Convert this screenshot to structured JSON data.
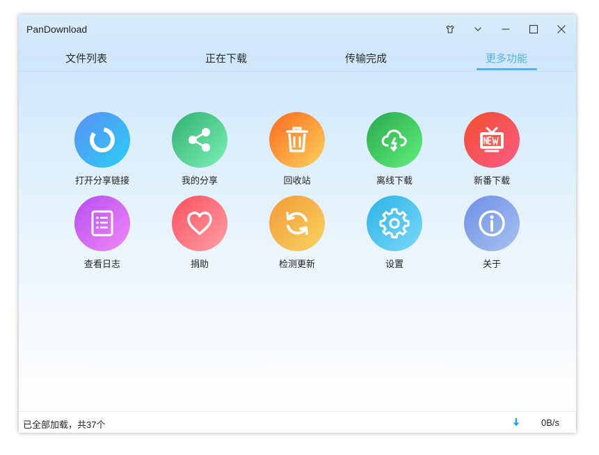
{
  "window": {
    "title": "PanDownload"
  },
  "tabs": [
    {
      "label": "文件列表",
      "active": false
    },
    {
      "label": "正在下载",
      "active": false
    },
    {
      "label": "传输完成",
      "active": false
    },
    {
      "label": "更多功能",
      "active": true
    }
  ],
  "features": [
    {
      "label": "打开分享链接",
      "icon": "ring-icon",
      "colors": [
        "#5b8ef5",
        "#28d0f5"
      ]
    },
    {
      "label": "我的分享",
      "icon": "share-icon",
      "colors": [
        "#2fb070",
        "#7ef0b8"
      ]
    },
    {
      "label": "回收站",
      "icon": "trash-icon",
      "colors": [
        "#fb6a1e",
        "#fcd25c"
      ]
    },
    {
      "label": "离线下载",
      "icon": "cloud-download-icon",
      "colors": [
        "#2aa84d",
        "#5ef07a"
      ]
    },
    {
      "label": "新番下载",
      "icon": "tv-icon",
      "colors": [
        "#f14d2e",
        "#fc5c86"
      ]
    },
    {
      "label": "查看日志",
      "icon": "list-icon",
      "colors": [
        "#b74bf0",
        "#f08af5"
      ]
    },
    {
      "label": "捐助",
      "icon": "heart-icon",
      "colors": [
        "#fc4f5b",
        "#fca0a8"
      ]
    },
    {
      "label": "检测更新",
      "icon": "refresh-icon",
      "colors": [
        "#f39a38",
        "#f8d360"
      ]
    },
    {
      "label": "设置",
      "icon": "gear-icon",
      "colors": [
        "#29b4e6",
        "#7cd7fa"
      ]
    },
    {
      "label": "关于",
      "icon": "info-icon",
      "colors": [
        "#6d8ee8",
        "#a8c2ef"
      ]
    }
  ],
  "status": {
    "text": "已全部加载，共37个",
    "speed": "0B/s"
  },
  "accent": "#5aaee6"
}
